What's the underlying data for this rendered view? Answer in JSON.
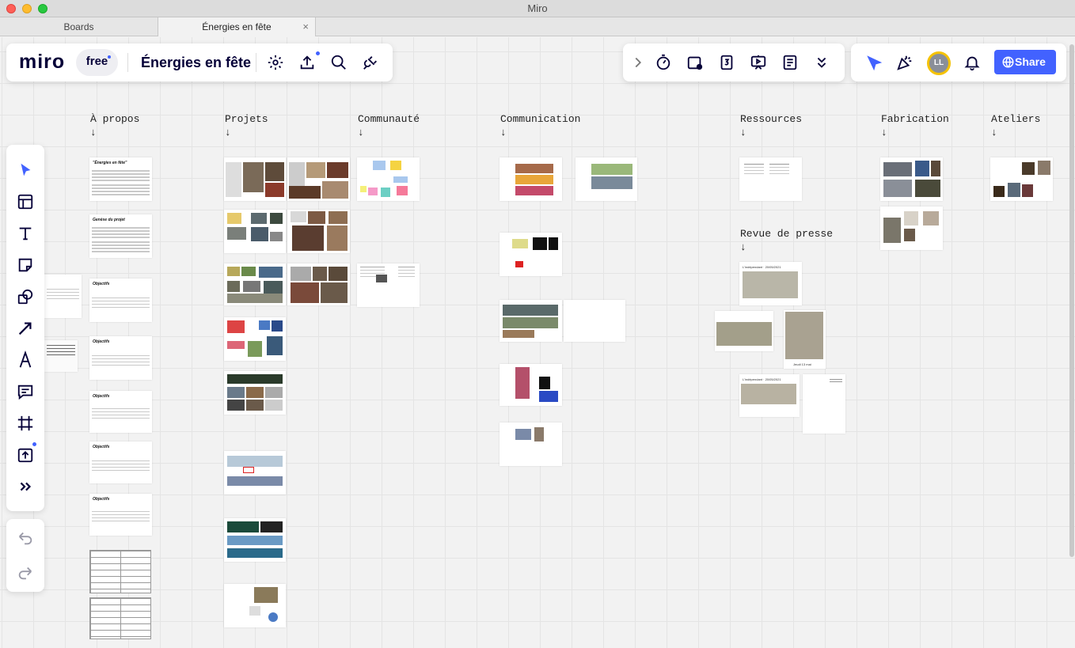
{
  "window": {
    "title": "Miro"
  },
  "tabs": [
    {
      "label": "Boards"
    },
    {
      "label": "Énergies en fête",
      "close": "×"
    }
  ],
  "header": {
    "logo": "miro",
    "plan": "free",
    "board_title": "Énergies en fête",
    "left_icons": [
      "gear-icon",
      "upload-icon",
      "search-icon",
      "plug-icon"
    ],
    "right_icons": [
      "chevron-right-icon",
      "timer-icon",
      "card-icon",
      "counter-icon",
      "present-icon",
      "notes-icon",
      "double-chevron-down-icon"
    ],
    "collab_icons": [
      "cursor-select-icon",
      "celebrate-icon",
      "avatar",
      "bell-icon"
    ],
    "avatar_initials": "LL",
    "share_label": "Share",
    "colors": {
      "accent": "#4262ff",
      "avatar_ring": "#f5c200"
    }
  },
  "toolbar": {
    "tools": [
      "select-icon",
      "templates-icon",
      "text-icon",
      "sticky-note-icon",
      "shapes-icon",
      "arrow-icon",
      "pen-icon",
      "comment-icon",
      "frame-icon",
      "upload-icon",
      "more-icon"
    ],
    "undo": "undo-icon",
    "redo": "redo-icon"
  },
  "sections": [
    {
      "label": "À propos\n↓"
    },
    {
      "label": "Projets\n↓"
    },
    {
      "label": "Communauté\n↓"
    },
    {
      "label": "Communication\n↓"
    },
    {
      "label": "Ressources\n↓"
    },
    {
      "label": "Fabrication\n↓"
    },
    {
      "label": "Ateliers\n↓"
    },
    {
      "label": "Revue de presse\n↓"
    }
  ],
  "cards": {
    "about_title": "\"Énergies en fête\"",
    "genesis": "Genèse du projet",
    "objectifs": "Objectifs",
    "press_date_1": "L'indépendant · 20/05/2021",
    "press_date_2": "L'indépendant · 20/05/2021",
    "press_caption": "Jeudi 13 mai"
  }
}
